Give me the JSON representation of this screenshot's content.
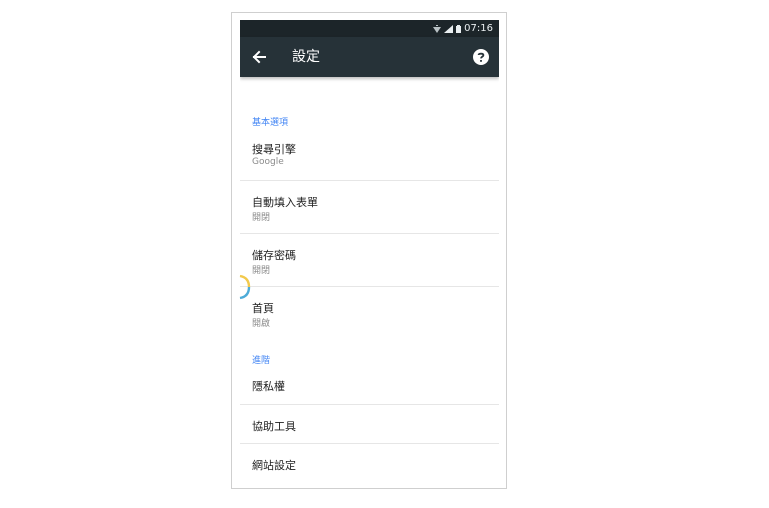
{
  "statusbar": {
    "time": "07:16"
  },
  "appbar": {
    "title": "設定"
  },
  "sections": {
    "basic": {
      "header": "基本選項"
    },
    "advanced": {
      "header": "進階"
    }
  },
  "items": {
    "search_engine": {
      "title": "搜尋引擎",
      "subtitle": "Google"
    },
    "autofill": {
      "title": "自動填入表單",
      "subtitle": "開閉"
    },
    "passwords": {
      "title": "儲存密碼",
      "subtitle": "開閉"
    },
    "homepage": {
      "title": "首頁",
      "subtitle": "開啟"
    },
    "privacy": {
      "title": "隱私權"
    },
    "accessibility": {
      "title": "協助工具"
    },
    "site_settings": {
      "title": "網站設定"
    }
  },
  "colors": {
    "accent": "#4285f4",
    "toolbar": "#263238",
    "statusbar": "#1c2529"
  }
}
